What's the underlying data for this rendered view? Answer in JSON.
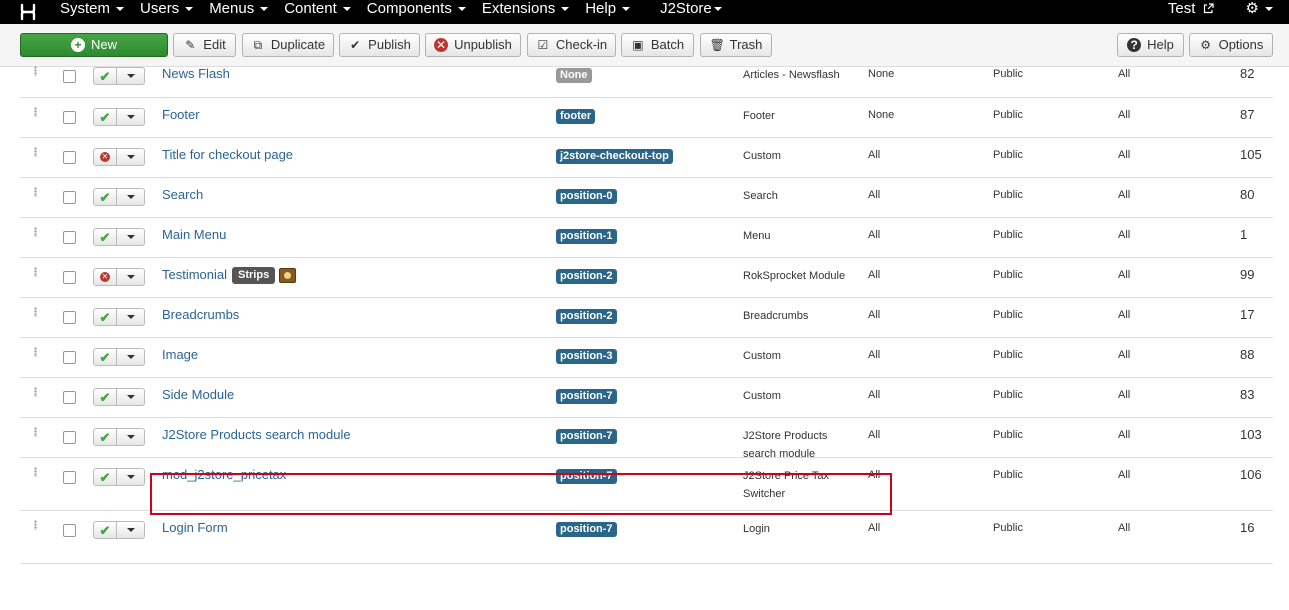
{
  "navbar": {
    "logo_icon": "joomla-logo-icon",
    "menus": [
      "System",
      "Users",
      "Menus",
      "Content",
      "Components",
      "Extensions",
      "Help",
      "J2Store"
    ],
    "user": "Test",
    "settings_icon": "gear-icon"
  },
  "toolbar": {
    "new": "New",
    "edit": "Edit",
    "duplicate": "Duplicate",
    "publish": "Publish",
    "unpublish": "Unpublish",
    "checkin": "Check-in",
    "batch": "Batch",
    "trash": "Trash",
    "help": "Help",
    "options": "Options"
  },
  "colors": {
    "link": "#2a6496",
    "badge": "#2b6589",
    "published": "#46a546",
    "unpublished": "#bd362f",
    "highlight": "#d0021b"
  },
  "modules": [
    {
      "title": "News Flash",
      "position": "None",
      "type": "Articles - Newsflash",
      "pages": "None",
      "access": "Public",
      "language": "All",
      "id": "82",
      "published": true
    },
    {
      "title": "Footer",
      "position": "footer",
      "type": "Footer",
      "pages": "None",
      "access": "Public",
      "language": "All",
      "id": "87",
      "published": true
    },
    {
      "title": "Title for checkout page",
      "position": "j2store-checkout-top",
      "type": "Custom",
      "pages": "All",
      "access": "Public",
      "language": "All",
      "id": "105",
      "published": false
    },
    {
      "title": "Search",
      "position": "position-0",
      "type": "Search",
      "pages": "All",
      "access": "Public",
      "language": "All",
      "id": "80",
      "published": true
    },
    {
      "title": "Main Menu",
      "position": "position-1",
      "type": "Menu",
      "pages": "All",
      "access": "Public",
      "language": "All",
      "id": "1",
      "published": true
    },
    {
      "title": "Testimonial",
      "tag": "Strips",
      "position": "position-2",
      "type": "RokSprocket Module",
      "pages": "All",
      "access": "Public",
      "language": "All",
      "id": "99",
      "published": false
    },
    {
      "title": "Breadcrumbs",
      "position": "position-2",
      "type": "Breadcrumbs",
      "pages": "All",
      "access": "Public",
      "language": "All",
      "id": "17",
      "published": true
    },
    {
      "title": "Image",
      "position": "position-3",
      "type": "Custom",
      "pages": "All",
      "access": "Public",
      "language": "All",
      "id": "88",
      "published": true
    },
    {
      "title": "Side Module",
      "position": "position-7",
      "type": "Custom",
      "pages": "All",
      "access": "Public",
      "language": "All",
      "id": "83",
      "published": true
    },
    {
      "title": "J2Store Products search module",
      "position": "position-7",
      "type": "J2Store Products search module",
      "pages": "All",
      "access": "Public",
      "language": "All",
      "id": "103",
      "published": true
    },
    {
      "title": "mod_j2store_pricetax",
      "position": "position-7",
      "type": "J2Store Price Tax Switcher",
      "pages": "All",
      "access": "Public",
      "language": "All",
      "id": "106",
      "published": true
    },
    {
      "title": "Login Form",
      "position": "position-7",
      "type": "Login",
      "pages": "All",
      "access": "Public",
      "language": "All",
      "id": "16",
      "published": true
    }
  ]
}
